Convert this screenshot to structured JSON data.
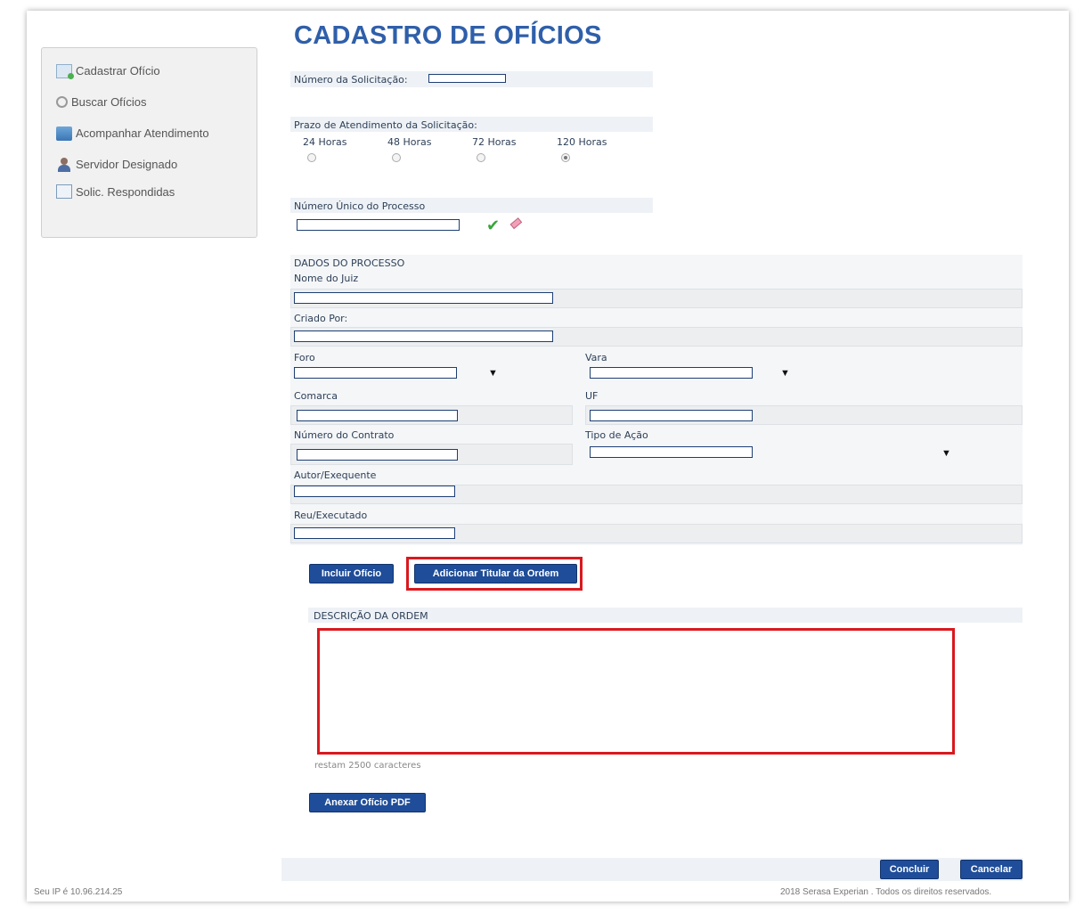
{
  "sidebar": {
    "items": [
      {
        "label": "Cadastrar Ofício",
        "icon": "document-add-icon"
      },
      {
        "label": "Buscar Ofícios",
        "icon": "search-icon"
      },
      {
        "label": "Acompanhar Atendimento",
        "icon": "chart-icon"
      },
      {
        "label": "Servidor Designado",
        "icon": "user-icon"
      },
      {
        "label": "Solic. Respondidas",
        "icon": "calendar-icon"
      }
    ]
  },
  "page": {
    "title": "CADASTRO DE OFÍCIOS"
  },
  "form": {
    "numero_solicitacao_label": "Número da Solicitação:",
    "prazo_label": "Prazo de Atendimento da Solicitação:",
    "prazo_options": [
      "24 Horas",
      "48 Horas",
      "72 Horas",
      "120 Horas"
    ],
    "prazo_selected": "120 Horas",
    "numero_unico_label": "Número Único do Processo",
    "dados_section": "DADOS DO PROCESSO",
    "nome_juiz_label": "Nome do Juiz",
    "criado_por_label": "Criado Por:",
    "foro_label": "Foro",
    "vara_label": "Vara",
    "comarca_label": "Comarca",
    "uf_label": "UF",
    "numero_contrato_label": "Número do Contrato",
    "tipo_acao_label": "Tipo de Ação",
    "autor_label": "Autor/Exequente",
    "reu_label": "Reu/Executado",
    "descricao_label": "DESCRIÇÃO DA ORDEM",
    "restam": "restam 2500 caracteres"
  },
  "buttons": {
    "incluir": "Incluir Ofício",
    "adicionar": "Adicionar Titular da Ordem",
    "anexar": "Anexar Ofício PDF",
    "concluir": "Concluir",
    "cancelar": "Cancelar"
  },
  "footer": {
    "ip": "Seu IP é 10.96.214.25",
    "copyright": "2018 Serasa Experian . Todos os direitos reservados."
  },
  "colors": {
    "accent": "#1f4d99",
    "title": "#2f5faa",
    "highlight": "#d9191f",
    "section_bg": "#eef2f6"
  }
}
